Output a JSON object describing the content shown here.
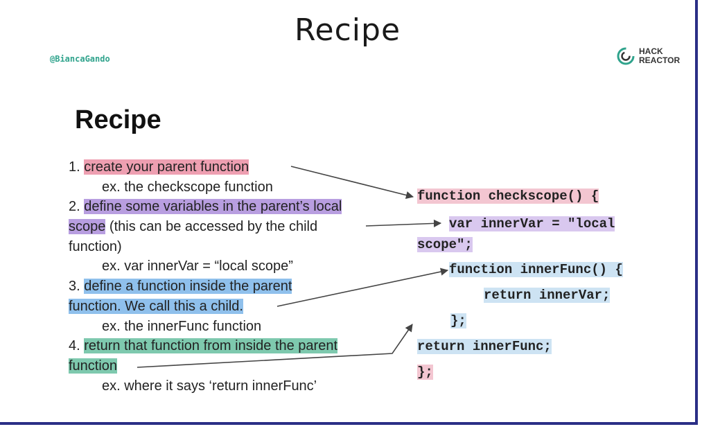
{
  "slide": {
    "title": "Recipe",
    "handle": "@BiancaGando",
    "logo_line1": "HACK",
    "logo_line2": "REACTOR",
    "heading": "Recipe"
  },
  "recipe": {
    "step1_num": "1. ",
    "step1_text": "create your parent function",
    "step1_ex": "ex. the checkscope function",
    "step2_num": "2. ",
    "step2_hl_a": "define some variables in the parent’s local",
    "step2_hl_b": "scope",
    "step2_rest_b": " (this can be accessed by the child",
    "step2_line3": "function)",
    "step2_ex": "ex. var innerVar = “local scope”",
    "step3_num": "3. ",
    "step3_hl_a": "define a function inside the parent",
    "step3_hl_b": "function. We call this a child.",
    "step3_ex": "ex. the innerFunc function",
    "step4_num": "4. ",
    "step4_hl_a": "return that function from inside the parent",
    "step4_hl_b": "function",
    "step4_ex": "ex. where it says ‘return innerFunc’"
  },
  "code": {
    "line1": "function checkscope() {",
    "line2": "var innerVar = \"local",
    "line3": "scope\";",
    "line4": "function innerFunc() {",
    "line5": "return innerVar;",
    "line6": "};",
    "line7": "return innerFunc;",
    "line8": "};"
  },
  "colors": {
    "highlight_pink": "#ee9fb1",
    "highlight_purple": "#b89ee0",
    "highlight_blue": "#8fc0ec",
    "highlight_green": "#7ec9ae",
    "frame_border": "#2b2f86",
    "handle_color": "#2fa38c"
  },
  "icons": {
    "logo": "hack-reactor-logo-icon"
  }
}
